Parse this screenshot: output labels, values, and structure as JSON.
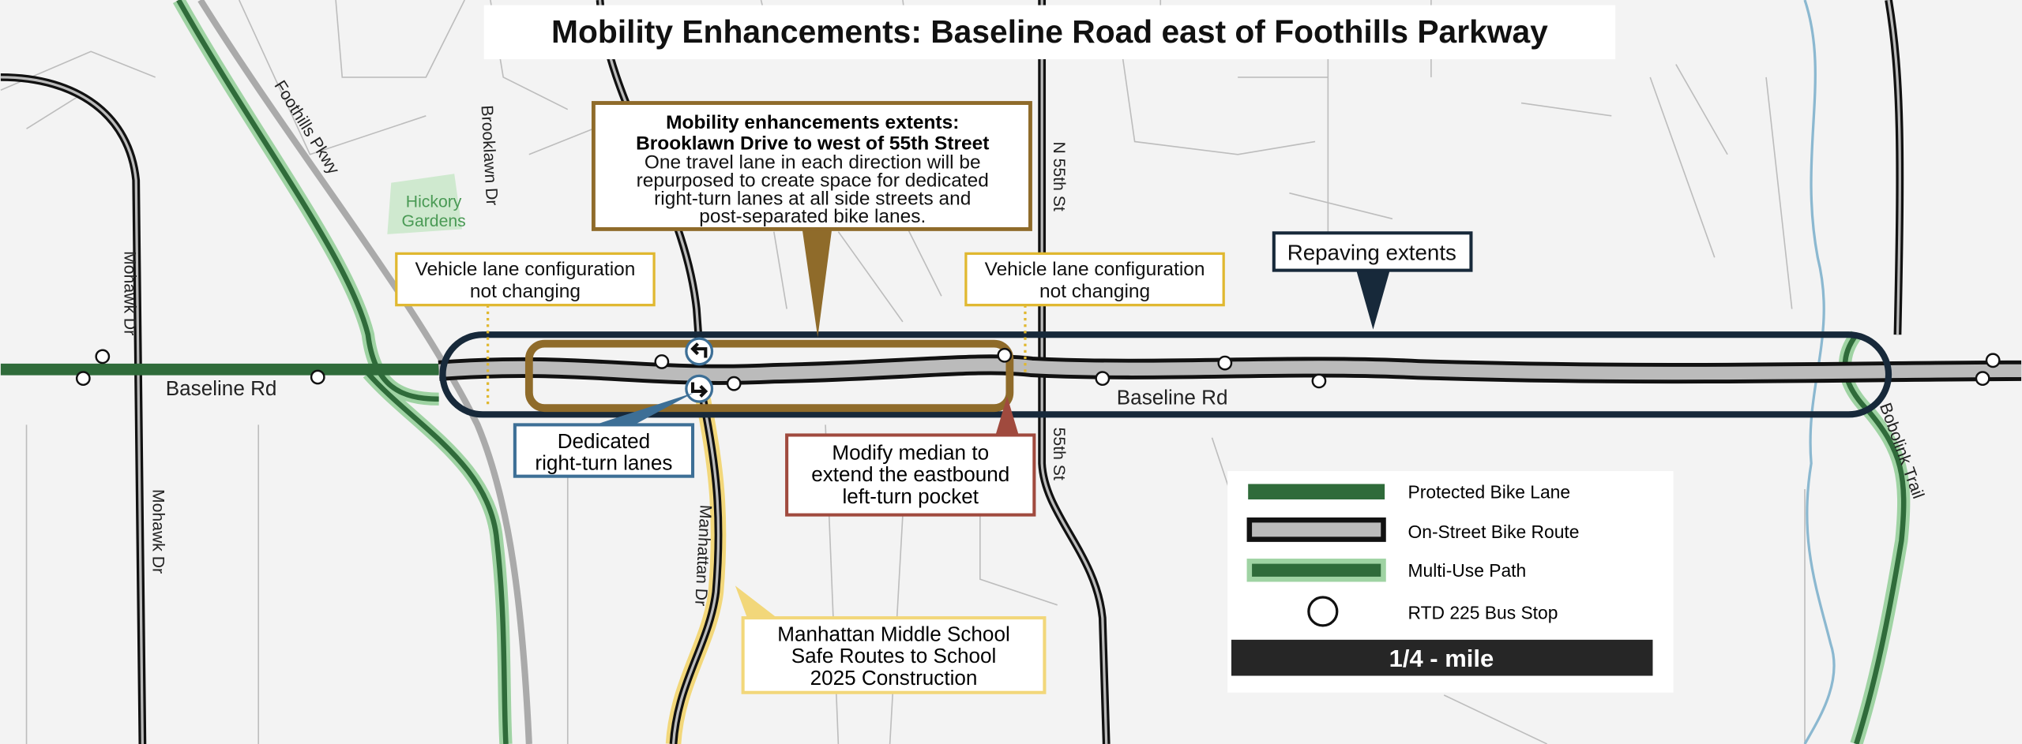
{
  "title": "Mobility Enhancements: Baseline Road east of Foothills Parkway",
  "colors": {
    "protected_bike_lane": "#2f6b3a",
    "multi_use_path_halo": "#9fd3a3",
    "on_street_bike_route": "#b9b9b9",
    "mobility_extent": "#8f6b2a",
    "repaving_extent": "#17293a",
    "right_turn_callout": "#3d6f96",
    "median_callout": "#a04a3e",
    "vehicle_lane_callout": "#e0b830",
    "school_route": "#f2d77a",
    "creek": "#8bb8d0"
  },
  "streets": {
    "foothills": "Foothills Pkwy",
    "brooklawn": "Brooklawn Dr",
    "n55th": "N 55th St",
    "s55th": "55th St",
    "mohawk_n": "Mohawk Dr",
    "mohawk_s": "Mohawk Dr",
    "baseline_w": "Baseline Rd",
    "baseline_e": "Baseline Rd",
    "manhattan": "Manhattan Dr",
    "bobolink": "Bobolink Trail",
    "park_line1": "Hickory",
    "park_line2": "Gardens"
  },
  "callouts": {
    "mobility": {
      "heading1": "Mobility enhancements extents:",
      "heading2": "Brooklawn Drive to west of 55th Street",
      "body": [
        "One travel lane in each direction will be",
        "repurposed to create space for dedicated",
        "right-turn lanes at all side streets and",
        "post-separated bike lanes."
      ]
    },
    "vehicle_west": [
      "Vehicle lane configuration",
      "not changing"
    ],
    "vehicle_east": [
      "Vehicle lane configuration",
      "not changing"
    ],
    "repaving": "Repaving extents",
    "right_turn": [
      "Dedicated",
      "right-turn lanes"
    ],
    "median": [
      "Modify median to",
      "extend the eastbound",
      "left-turn pocket"
    ],
    "school": [
      "Manhattan Middle School",
      "Safe Routes to School",
      "2025 Construction"
    ]
  },
  "legend": {
    "items": [
      {
        "label": "Protected Bike Lane",
        "icon": "protected-bike-lane-swatch"
      },
      {
        "label": "On-Street Bike Route",
        "icon": "on-street-bike-route-swatch"
      },
      {
        "label": "Multi-Use Path",
        "icon": "multi-use-path-swatch"
      },
      {
        "label": "RTD 225 Bus Stop",
        "icon": "bus-stop-circle"
      }
    ],
    "scale": "1/4 - mile"
  }
}
